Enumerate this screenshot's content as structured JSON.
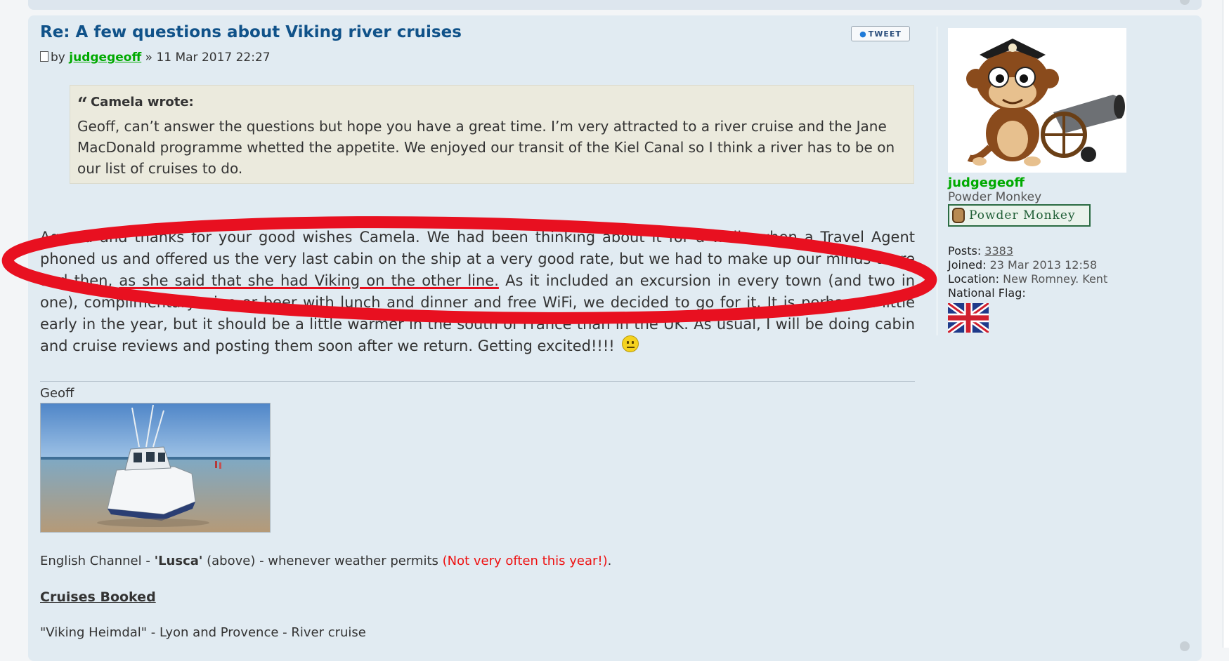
{
  "post": {
    "title": "Re: A few questions about Viking river cruises",
    "by_label": "by",
    "author": "judgegeoff",
    "date_sep": " » ",
    "date": "11 Mar 2017 22:27",
    "tweet_label": "TWEET",
    "quote": {
      "cite": "Camela wrote:",
      "text": "Geoff, can’t answer the questions but hope you have a great time. I’m very attracted to a river cruise and the Jane MacDonald programme whetted the appetite. We enjoyed our transit of the Kiel Canal so I think a river has to be on our list of cruises to do."
    },
    "body_part1": "Agreed and thanks for your good wishes Camela. We had been thinking about it for a while when a Travel Agent phoned us and offered us the very last cabin on the ship at a very good rate, but we had to make up our minds there and then, ",
    "body_underlined": "as she said that she had Viking on the other line.",
    "body_part2": " As it included an excursion in every town (and two in one), complimentary wine or beer with lunch and dinner and free WiFi, we decided to go for it. It is perhaps a little early in the year, but it should be a little warmer in the south of France than in the UK. As usual, I will be doing cabin and cruise reviews and posting them soon after we return. Getting excited!!!!",
    "smiley_icon": "grin-smiley-icon"
  },
  "signature": {
    "name": "Geoff",
    "boat_prefix": "English Channel - ",
    "boat_name": "'Lusca'",
    "boat_suffix": " (above) - whenever weather permits ",
    "boat_note": "(Not very often this year!)",
    "boat_end": ".",
    "heading": "Cruises Booked",
    "cruise": "\"Viking Heimdal\" - Lyon and Provence - River cruise"
  },
  "profile": {
    "username": "judgegeoff",
    "rank": "Powder Monkey",
    "rank_badge": "Powder Monkey",
    "posts_label": "Posts:",
    "posts": "3383",
    "joined_label": "Joined:",
    "joined": "23 Mar 2013 12:58",
    "location_label": "Location:",
    "location": "New Romney. Kent",
    "flag_label": "National Flag:",
    "flag_icon": "union-jack-flag-icon"
  },
  "colors": {
    "post_bg": "#e1ebf2",
    "title": "#105289",
    "author": "#00aa00",
    "annotation": "#e81020",
    "quote_bg": "#ebeadd"
  }
}
